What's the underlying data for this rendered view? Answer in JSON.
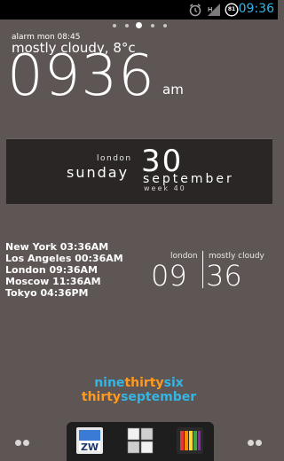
{
  "status_bar": {
    "time": "09:36",
    "icons": [
      "alarm-icon",
      "signal-icon",
      "battery-icon"
    ],
    "battery_level_text": "81",
    "accent_color": "#33b5e5"
  },
  "home_pages": {
    "count": 5,
    "active_index": 2
  },
  "clock_widget": {
    "alarm": "alarm mon 08:45",
    "weather": "mostly cloudy, 8°c",
    "hour": "09",
    "minute": "36",
    "ampm": "am"
  },
  "date_widget": {
    "city": "london",
    "weekday": "sunday",
    "day": "30",
    "month": "september",
    "week": "week 40"
  },
  "world_clock": {
    "rows": [
      "New York 03:36AM",
      "Los Angeles 00:36AM",
      "London 09:36AM",
      "Moscow 11:36AM",
      "Tokyo 04:36PM"
    ]
  },
  "split_clock": {
    "location": "london",
    "weather": "mostly cloudy",
    "hour": "09",
    "minute": "36"
  },
  "word_clock": {
    "line1": [
      "nine",
      "thirty",
      "six"
    ],
    "line2": [
      "thirty",
      "september"
    ],
    "colors": {
      "blue": "#33b5e5",
      "orange": "#ff9a1f"
    }
  },
  "dock": {
    "items": [
      {
        "icon": "zw-app-icon",
        "text": "ZW"
      },
      {
        "icon": "app-drawer-icon"
      },
      {
        "icon": "color-bars-app-icon"
      }
    ]
  }
}
